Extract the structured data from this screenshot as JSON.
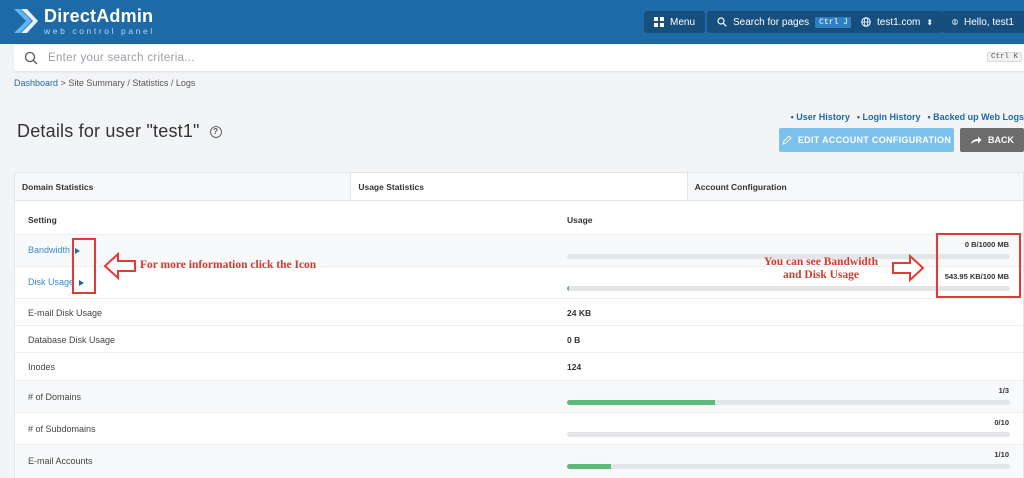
{
  "app": {
    "title": "DirectAdmin",
    "subtitle": "web control panel"
  },
  "topbar": {
    "menu_label": "Menu",
    "search_label": "Search for pages",
    "search_shortcut": "Ctrl J",
    "domain_label": "test1.com",
    "user_label": "Hello, test1"
  },
  "search": {
    "placeholder": "Enter your search criteria...",
    "shortcut": "Ctrl K"
  },
  "breadcrumb": {
    "home": "Dashboard",
    "separator": ">",
    "current": "Site Summary / Statistics / Logs"
  },
  "page": {
    "title": "Details for user \"test1\"",
    "help_glyph": "?"
  },
  "links": {
    "user_history": "User History",
    "login_history": "Login History",
    "backed_up_logs": "Backed up Web Logs"
  },
  "actions": {
    "edit_label": "EDIT ACCOUNT CONFIGURATION",
    "back_label": "BACK"
  },
  "tabs": [
    "Domain Statistics",
    "Usage Statistics",
    "Account Configuration"
  ],
  "table": {
    "header_setting": "Setting",
    "header_usage": "Usage",
    "rows": [
      {
        "setting": "Bandwidth",
        "value": "0 B/1000 MB",
        "fraction": 0
      },
      {
        "setting": "Disk Usage",
        "value": "543.95 KB/100 MB",
        "fraction": 0.005
      },
      {
        "setting": "E-mail Disk Usage",
        "value": "24 KB"
      },
      {
        "setting": "Database Disk Usage",
        "value": "0 B"
      },
      {
        "setting": "Inodes",
        "value": "124"
      },
      {
        "setting": "# of Domains",
        "value": "1/3",
        "fraction": 0.333
      },
      {
        "setting": "# of Subdomains",
        "value": "0/10",
        "fraction": 0
      },
      {
        "setting": "E-mail Accounts",
        "value": "1/10",
        "fraction": 0.1
      }
    ]
  },
  "annotations": {
    "left": "For more information click the Icon",
    "right_line1": "You can see Bandwidth",
    "right_line2": "and Disk Usage"
  },
  "colors": {
    "topbar": "#1e6aa6",
    "bar_fill": "#5dba79",
    "annotation": "#e23a35"
  }
}
